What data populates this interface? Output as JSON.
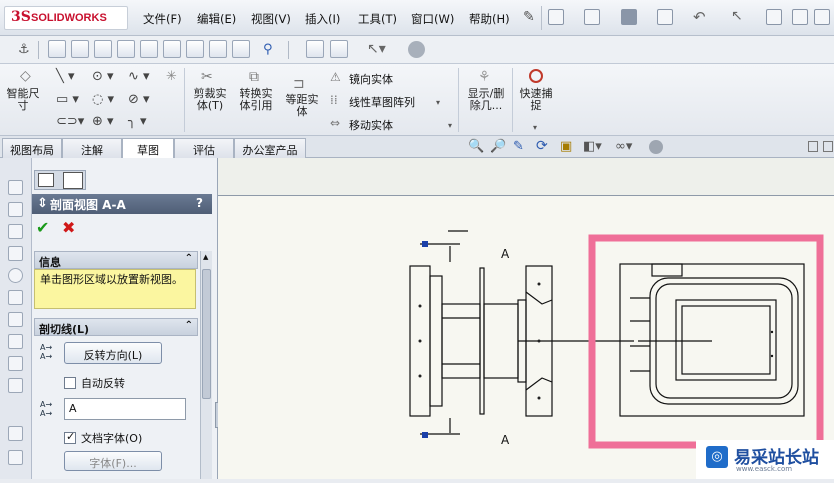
{
  "app": {
    "brand_prefix": "3S",
    "brand_name": "SOLIDWORKS"
  },
  "menu": [
    "文件(F)",
    "编辑(E)",
    "视图(V)",
    "插入(I)",
    "工具(T)",
    "窗口(W)",
    "帮助(H)"
  ],
  "ribbon": {
    "smart_dim": "智能尺寸",
    "trim": "剪裁实体(T)",
    "convert": "转换实体引用",
    "offset": "等距实体",
    "mirror": "镜向实体",
    "linear_pattern": "线性草图阵列",
    "move": "移动实体",
    "show_delete": "显示/删除几...",
    "quick_snap": "快速捕捉"
  },
  "tabs": [
    "视图布局",
    "注解",
    "草图",
    "评估",
    "办公室产品"
  ],
  "active_tab": "草图",
  "pm": {
    "title": "剖面视图 A-A",
    "help": "?",
    "info_header": "信息",
    "info_text": "单击图形区域以放置新视图。",
    "cutline_header": "剖切线(L)",
    "reverse_btn": "反转方向(L)",
    "auto_flip": "自动反转",
    "label_value": "A",
    "doc_font": "文档字体(O)",
    "font_btn": "字体(F)..."
  },
  "drawing": {
    "label_top": "A",
    "label_bottom": "A"
  },
  "watermark": {
    "site": "易采站长站",
    "sub": "www.easck.com"
  },
  "colors": {
    "highlight": "#ef6f98",
    "pm_header": "#56657d",
    "info_bg": "#fbf6a0",
    "ok": "#1a9a1a",
    "cancel": "#d01818"
  }
}
